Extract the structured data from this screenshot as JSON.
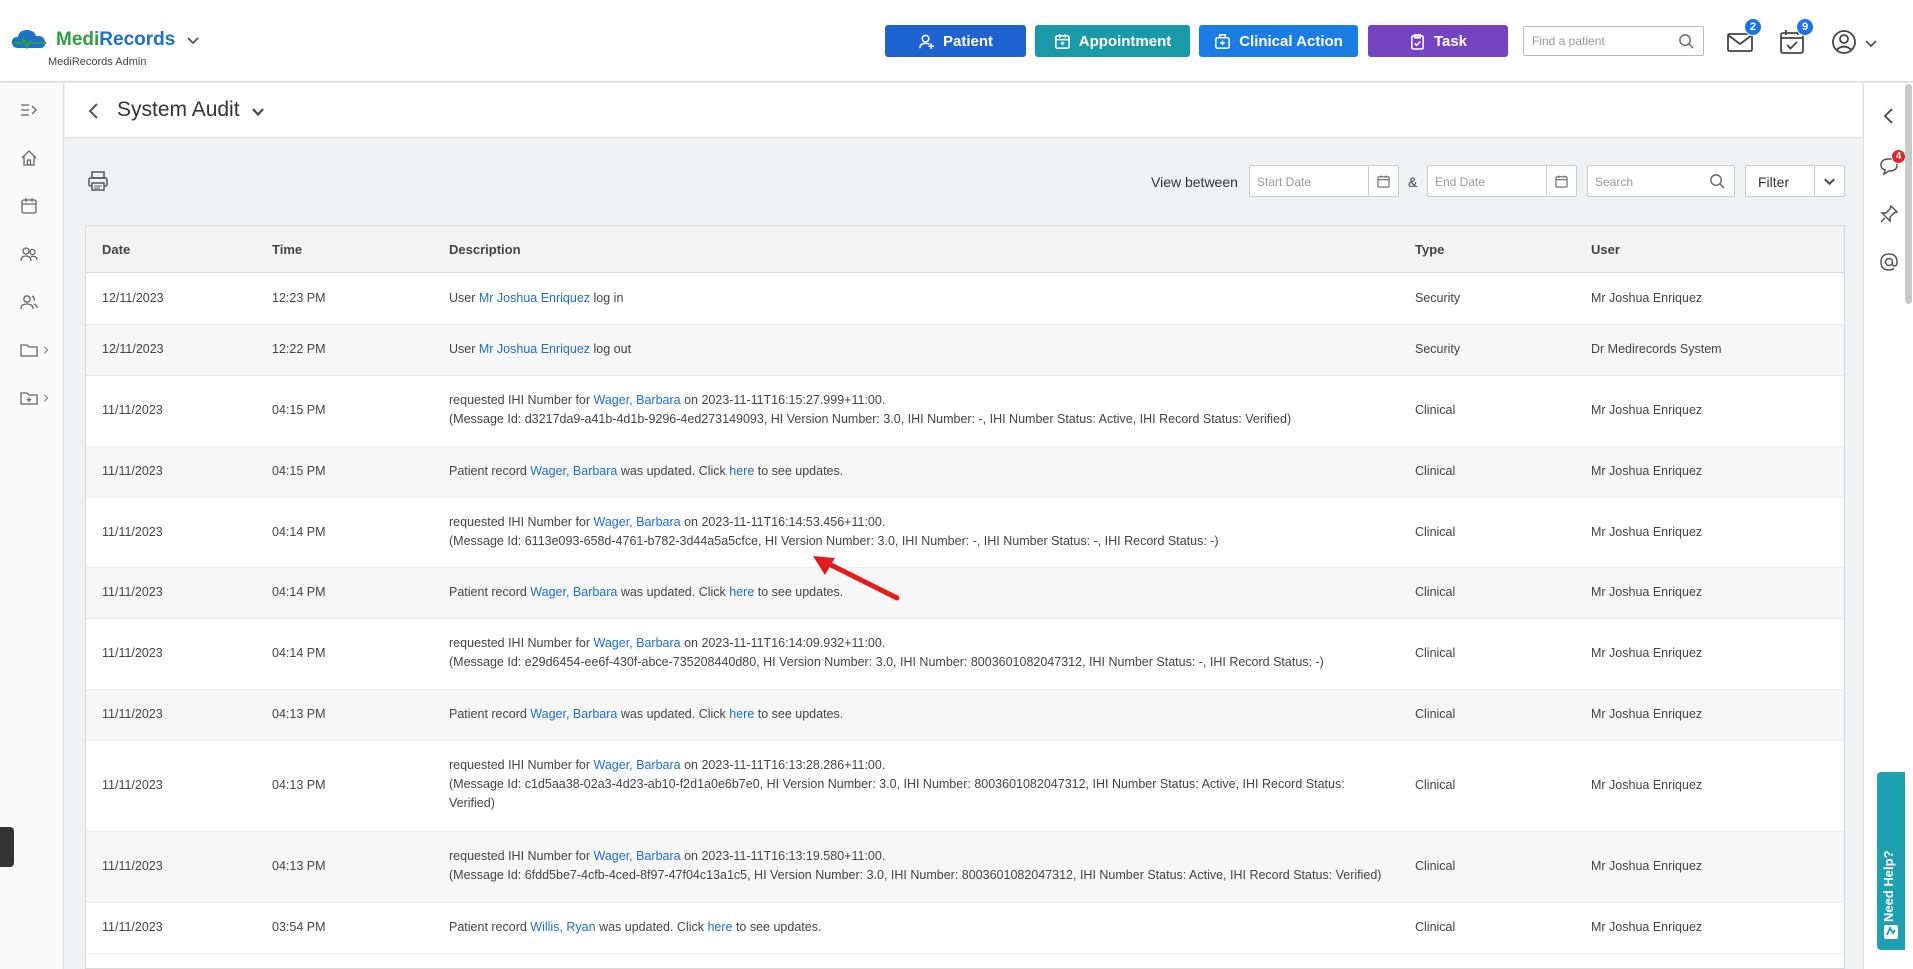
{
  "brand": {
    "name_part1": "Medi",
    "name_part2": "Records",
    "subtitle": "MediRecords Admin"
  },
  "topbar": {
    "patient_label": "Patient",
    "appointment_label": "Appointment",
    "clinical_label": "Clinical Action",
    "task_label": "Task",
    "find_placeholder": "Find a patient",
    "mail_badge": "2",
    "tasks_badge": "9"
  },
  "page": {
    "title": "System Audit"
  },
  "filters": {
    "view_between_label": "View between",
    "start_placeholder": "Start Date",
    "amp": "&",
    "end_placeholder": "End Date",
    "search_placeholder": "Search",
    "filter_value": "Filter"
  },
  "rightrail": {
    "chat_badge": "4",
    "help_label": "Need Help?"
  },
  "table": {
    "headers": {
      "date": "Date",
      "time": "Time",
      "description": "Description",
      "type": "Type",
      "user": "User"
    },
    "rows": [
      {
        "date": "12/11/2023",
        "time": "12:23 PM",
        "d_pre": "User ",
        "d_link": "Mr Joshua Enriquez",
        "d_post": " log in",
        "type": "Security",
        "user": "Mr Joshua Enriquez"
      },
      {
        "date": "12/11/2023",
        "time": "12:22 PM",
        "d_pre": "User ",
        "d_link": "Mr Joshua Enriquez",
        "d_post": " log out",
        "type": "Security",
        "user": "Dr Medirecords System"
      },
      {
        "date": "11/11/2023",
        "time": "04:15 PM",
        "d_pre": "requested IHI Number for ",
        "d_link": "Wager, Barbara",
        "d_post": " on 2023-11-11T16:15:27.999+11:00.",
        "d_line2": "(Message Id: d3217da9-a41b-4d1b-9296-4ed273149093, HI Version Number: 3.0, IHI Number: -, IHI Number Status: Active, IHI Record Status: Verified)",
        "type": "Clinical",
        "user": "Mr Joshua Enriquez"
      },
      {
        "date": "11/11/2023",
        "time": "04:15 PM",
        "d_pre": "Patient record ",
        "d_link": "Wager, Barbara",
        "d_mid": " was updated. Click ",
        "d_link2": "here",
        "d_post": " to see updates.",
        "type": "Clinical",
        "user": "Mr Joshua Enriquez"
      },
      {
        "date": "11/11/2023",
        "time": "04:14 PM",
        "d_pre": "requested IHI Number for ",
        "d_link": "Wager, Barbara",
        "d_post": " on 2023-11-11T16:14:53.456+11:00.",
        "d_line2": "(Message Id: 6113e093-658d-4761-b782-3d44a5a5cfce, HI Version Number: 3.0, IHI Number: -, IHI Number Status: -, IHI Record Status: -)",
        "type": "Clinical",
        "user": "Mr Joshua Enriquez"
      },
      {
        "date": "11/11/2023",
        "time": "04:14 PM",
        "d_pre": "Patient record ",
        "d_link": "Wager, Barbara",
        "d_mid": " was updated. Click ",
        "d_link2": "here",
        "d_post": " to see updates.",
        "type": "Clinical",
        "user": "Mr Joshua Enriquez"
      },
      {
        "date": "11/11/2023",
        "time": "04:14 PM",
        "d_pre": "requested IHI Number for ",
        "d_link": "Wager, Barbara",
        "d_post": " on 2023-11-11T16:14:09.932+11:00.",
        "d_line2": "(Message Id: e29d6454-ee6f-430f-abce-735208440d80, HI Version Number: 3.0, IHI Number: 8003601082047312, IHI Number Status: -, IHI Record Status: -)",
        "type": "Clinical",
        "user": "Mr Joshua Enriquez"
      },
      {
        "date": "11/11/2023",
        "time": "04:13 PM",
        "d_pre": "Patient record ",
        "d_link": "Wager, Barbara",
        "d_mid": " was updated. Click ",
        "d_link2": "here",
        "d_post": " to see updates.",
        "type": "Clinical",
        "user": "Mr Joshua Enriquez"
      },
      {
        "date": "11/11/2023",
        "time": "04:13 PM",
        "d_pre": "requested IHI Number for ",
        "d_link": "Wager, Barbara",
        "d_post": " on 2023-11-11T16:13:28.286+11:00.",
        "d_line2": "(Message Id: c1d5aa38-02a3-4d23-ab10-f2d1a0e6b7e0, HI Version Number: 3.0, IHI Number: 8003601082047312, IHI Number Status: Active, IHI Record Status:",
        "d_line3": "Verified)",
        "type": "Clinical",
        "user": "Mr Joshua Enriquez"
      },
      {
        "date": "11/11/2023",
        "time": "04:13 PM",
        "d_pre": "requested IHI Number for ",
        "d_link": "Wager, Barbara",
        "d_post": " on 2023-11-11T16:13:19.580+11:00.",
        "d_line2": "(Message Id: 6fdd5be7-4cfb-4ced-8f97-47f04c13a1c5, HI Version Number: 3.0, IHI Number: 8003601082047312, IHI Number Status: Active, IHI Record Status: Verified)",
        "type": "Clinical",
        "user": "Mr Joshua Enriquez"
      },
      {
        "date": "11/11/2023",
        "time": "03:54 PM",
        "d_pre": "Patient record ",
        "d_link": "Willis, Ryan",
        "d_mid": " was updated. Click ",
        "d_link2": "here",
        "d_post": " to see updates.",
        "type": "Clinical",
        "user": "Mr Joshua Enriquez"
      }
    ]
  }
}
